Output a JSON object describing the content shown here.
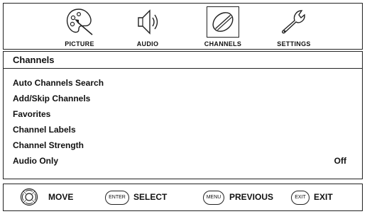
{
  "tabs": [
    {
      "label": "PICTURE",
      "icon": "palette-icon"
    },
    {
      "label": "AUDIO",
      "icon": "speaker-icon"
    },
    {
      "label": "CHANNELS",
      "icon": "satellite-dish-icon",
      "selected": true
    },
    {
      "label": "SETTINGS",
      "icon": "wrench-icon"
    }
  ],
  "panel": {
    "title": "Channels",
    "items": [
      {
        "label": "Auto Channels Search",
        "value": ""
      },
      {
        "label": "Add/Skip Channels",
        "value": ""
      },
      {
        "label": "Favorites",
        "value": ""
      },
      {
        "label": "Channel Labels",
        "value": ""
      },
      {
        "label": "Channel Strength",
        "value": ""
      },
      {
        "label": "Audio Only",
        "value": "Off"
      }
    ]
  },
  "hints": [
    {
      "key": "",
      "key_icon": "navigation-pad-icon",
      "label": "MOVE"
    },
    {
      "key": "ENTER",
      "label": "SELECT"
    },
    {
      "key": "MENU",
      "label": "PREVIOUS"
    },
    {
      "key": "EXIT",
      "label": "EXIT"
    }
  ]
}
